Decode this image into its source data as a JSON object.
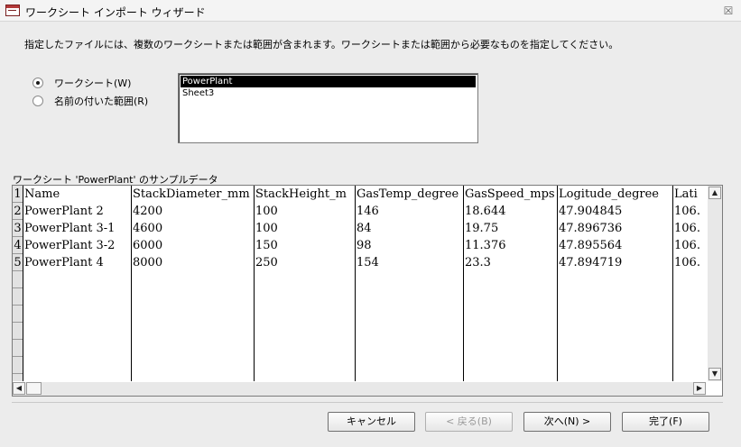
{
  "window": {
    "title": "ワークシート インポート ウィザード",
    "close_glyph": "☒"
  },
  "instruction": "指定したファイルには、複数のワークシートまたは範囲が含まれます。ワークシートまたは範囲から必要なものを指定してください。",
  "options": [
    {
      "label": "ワークシート(W)",
      "checked": true
    },
    {
      "label": "名前の付いた範囲(R)",
      "checked": false
    }
  ],
  "sheets": [
    {
      "name": "PowerPlant",
      "selected": true
    },
    {
      "name": "Sheet3",
      "selected": false
    }
  ],
  "sample_label": "ワークシート 'PowerPlant' のサンプルデータ",
  "grid": {
    "row_numbers": [
      "1",
      "2",
      "3",
      "4",
      "5",
      "",
      "",
      "",
      "",
      "",
      ""
    ],
    "columns": [
      {
        "cells": [
          "Name",
          "PowerPlant 2",
          "PowerPlant 3-1",
          "PowerPlant 3-2",
          "PowerPlant 4"
        ]
      },
      {
        "cells": [
          "StackDiameter_mm",
          "4200",
          "4600",
          "6000",
          "8000"
        ]
      },
      {
        "cells": [
          "StackHeight_m",
          "100",
          "100",
          "150",
          "250"
        ]
      },
      {
        "cells": [
          "GasTemp_degree",
          "146",
          "84",
          "98",
          "154"
        ]
      },
      {
        "cells": [
          "GasSpeed_mps",
          "18.644",
          "19.75",
          "11.376",
          "23.3"
        ]
      },
      {
        "cells": [
          "Logitude_degree",
          "47.904845",
          "47.896736",
          "47.895564",
          "47.894719"
        ]
      },
      {
        "cells": [
          "Lati",
          "106.",
          "106.",
          "106.",
          "106."
        ]
      }
    ]
  },
  "scroll": {
    "up": "▲",
    "down": "▼",
    "left": "◀",
    "right": "▶"
  },
  "buttons": {
    "cancel": "キャンセル",
    "back": "< 戻る(B)",
    "next": "次へ(N) >",
    "finish": "完了(F)"
  }
}
